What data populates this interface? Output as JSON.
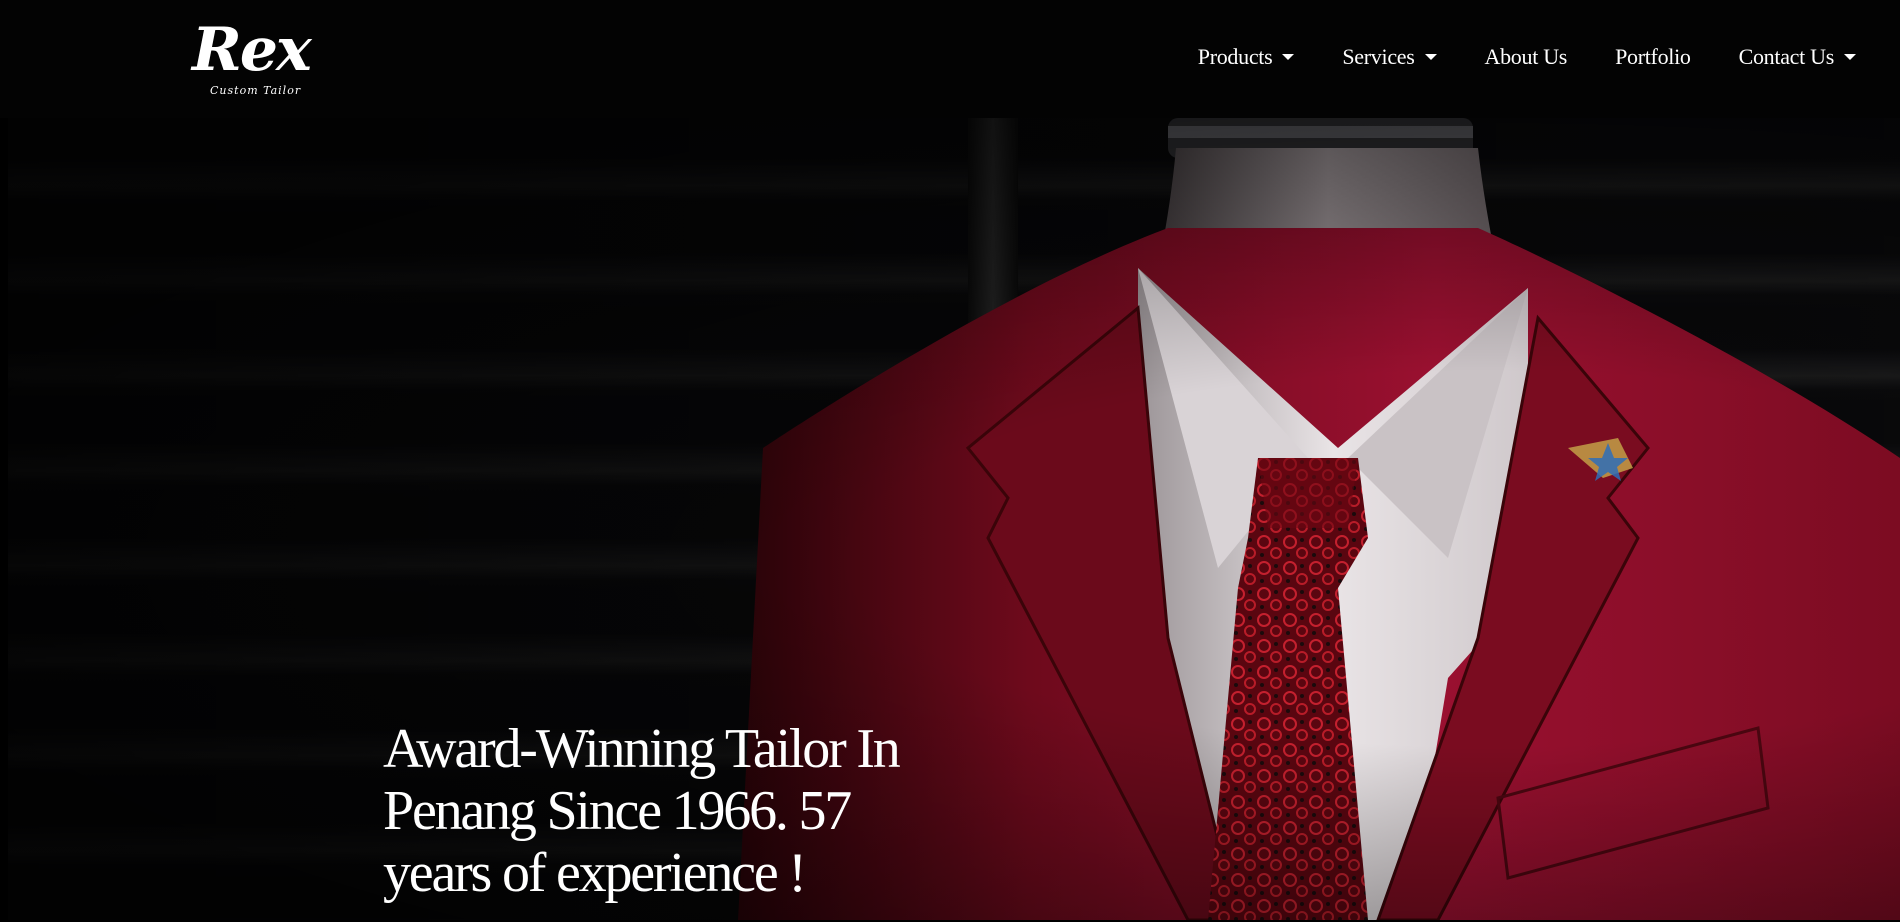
{
  "header": {
    "logo": {
      "mark": "Rex",
      "subtitle": "Custom Tailor"
    },
    "nav": [
      {
        "label": "Products",
        "has_dropdown": true
      },
      {
        "label": "Services",
        "has_dropdown": true
      },
      {
        "label": "About Us",
        "has_dropdown": false
      },
      {
        "label": "Portfolio",
        "has_dropdown": false
      },
      {
        "label": "Contact Us",
        "has_dropdown": true
      }
    ]
  },
  "hero": {
    "title_lines": [
      "Award-Winning Tailor In",
      "Penang Since 1966. 57",
      "years of experience !"
    ],
    "colors": {
      "suit": "#8e0c25",
      "shirt": "#e9e4e6",
      "tie": "#7a0b14",
      "background": "#050506"
    }
  }
}
